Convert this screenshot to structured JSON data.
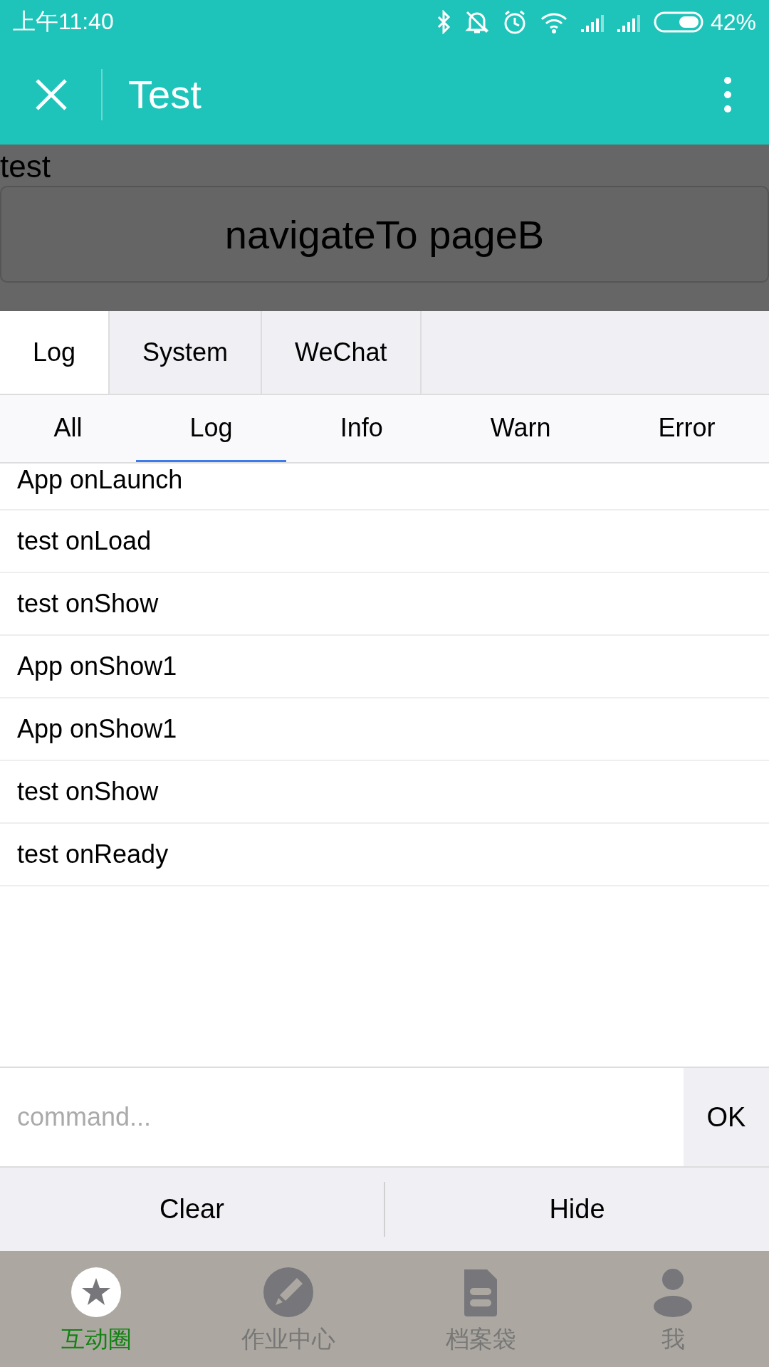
{
  "status_bar": {
    "time": "上午11:40",
    "battery": "42%"
  },
  "header": {
    "title": "Test"
  },
  "page": {
    "text": "test",
    "button": "navigateTo pageB"
  },
  "console": {
    "tabs": [
      {
        "label": "Log",
        "selected": true
      },
      {
        "label": "System",
        "selected": false
      },
      {
        "label": "WeChat",
        "selected": false
      }
    ],
    "filters": [
      {
        "label": "All",
        "selected": false
      },
      {
        "label": "Log",
        "selected": true
      },
      {
        "label": "Info",
        "selected": false
      },
      {
        "label": "Warn",
        "selected": false
      },
      {
        "label": "Error",
        "selected": false
      }
    ],
    "logs": [
      "App onLaunch",
      "test onLoad",
      "test onShow",
      "App onShow1",
      "App onShow1",
      "test onShow",
      "test onReady"
    ],
    "command": {
      "placeholder": "command..."
    },
    "ok": "OK",
    "actions": [
      "Clear",
      "Hide"
    ]
  },
  "tab_bar": [
    {
      "label": "互动圈",
      "selected": true
    },
    {
      "label": "作业中心",
      "selected": false
    },
    {
      "label": "档案袋",
      "selected": false
    },
    {
      "label": "我",
      "selected": false
    }
  ]
}
